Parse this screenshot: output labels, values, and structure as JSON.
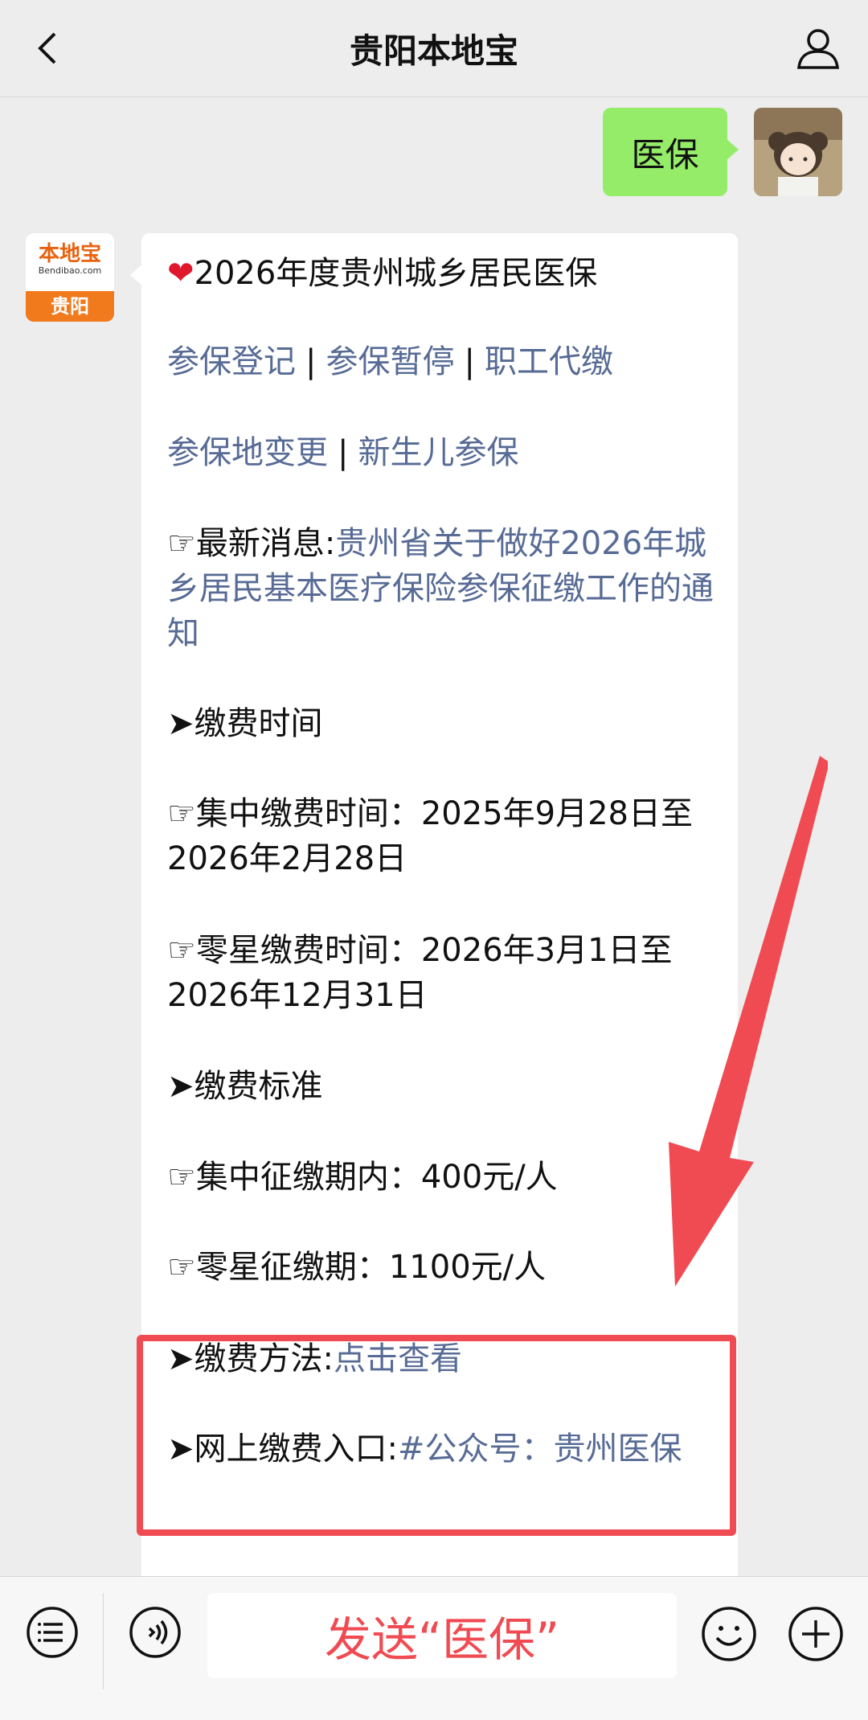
{
  "nav": {
    "title": "贵阳本地宝"
  },
  "chat": {
    "my_message": "医保",
    "bot_logo": {
      "main": "本地宝",
      "sub": "Bendibao.com",
      "city": "贵阳"
    },
    "reply": {
      "title": "2026年度贵州城乡居民医保",
      "links_row1": [
        "参保登记",
        "参保暂停",
        "职工代缴"
      ],
      "links_row2": [
        "参保地变更",
        "新生儿参保"
      ],
      "separator": "|",
      "news_prefix": "☞最新消息:",
      "news_link": "贵州省关于做好2026年城乡居民基本医疗保险参保征缴工作的通知",
      "section_time": "➤缴费时间",
      "time_central": "☞集中缴费时间：2025年9月28日至2026年2月28日",
      "time_scattered": "☞零星缴费时间：2026年3月1日至2026年12月31日",
      "section_standard": "➤缴费标准",
      "std_central": "☞集中征缴期内：400元/人",
      "std_scattered": "☞零星征缴期：1100元/人",
      "method_prefix": "➤缴费方法:",
      "method_link": "点击查看",
      "online_prefix": "➤网上缴费入口:",
      "online_link": "#公众号：贵州医保"
    }
  },
  "bottom": {
    "send_hint": "发送“医保”"
  },
  "colors": {
    "link": "#576b95",
    "my_bubble": "#95ec69",
    "highlight": "#f04b52"
  }
}
